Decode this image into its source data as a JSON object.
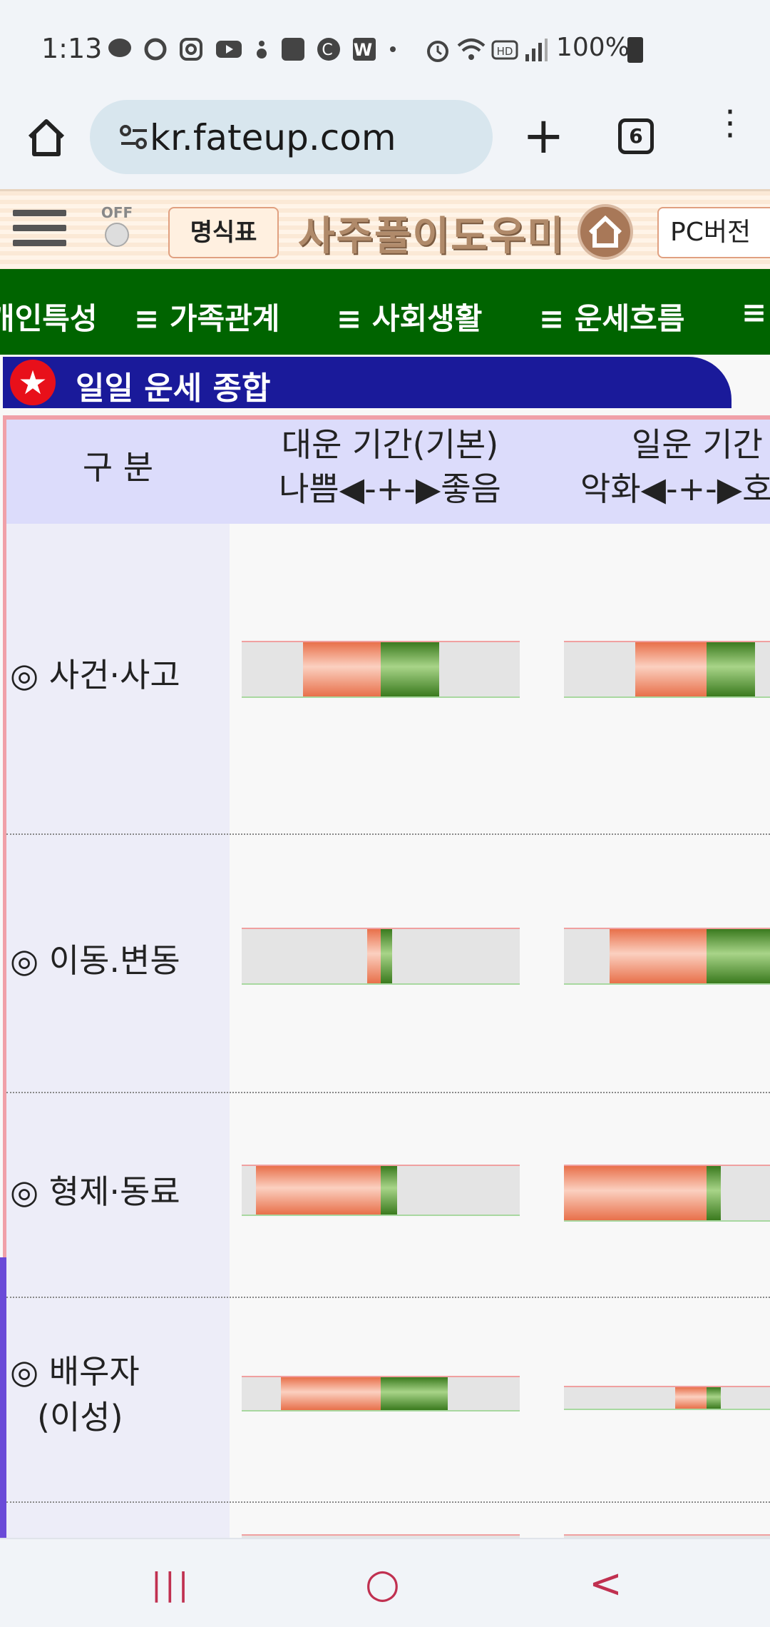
{
  "status_bar": {
    "time": "1:13",
    "battery": "100%",
    "icons": [
      "talk-icon",
      "chat-icon",
      "instagram-icon",
      "youtube-icon",
      "app-icon",
      "ably-icon",
      "c-icon",
      "w-icon",
      "dot-icon",
      "alarm-icon",
      "wifi-icon",
      "hd-icon",
      "signal-icon",
      "battery-icon"
    ]
  },
  "browser": {
    "url": "kr.fateup.com",
    "tab_count": "6"
  },
  "site_header": {
    "menu_label": "명식표",
    "bulb_label": "OFF",
    "logo_text": "사주풀이도우미",
    "pc_label": "PC버전"
  },
  "nav": {
    "items": [
      "개인특성",
      "≡ 가족관계",
      "≡ 사회생활",
      "≡ 운세흐름",
      "≡"
    ]
  },
  "section": {
    "title": "일일 운세 종합"
  },
  "table": {
    "header": {
      "col0": "구 분",
      "col1_line1": "대운 기간(기본)",
      "col1_line2": "나쁨◀-+-▶좋음",
      "col2_line1": "일운 기간",
      "col2_line2": "악화◀-+-▶호"
    },
    "rows": [
      {
        "label": "◎ 사건·사고",
        "label2": "",
        "col1": {
          "neg": 0.28,
          "pos": 0.21
        },
        "col2": {
          "neg": 0.25,
          "pos": 0.17
        }
      },
      {
        "label": "◎ 이동.변동",
        "label2": "",
        "col1": {
          "neg": 0.05,
          "pos": 0.04
        },
        "col2": {
          "neg": 0.34,
          "pos": 0.26
        }
      },
      {
        "label": "◎ 형제·동료",
        "label2": "",
        "col1": {
          "neg": 0.45,
          "pos": 0.06
        },
        "col2": {
          "neg": 0.6,
          "pos": 0.05
        }
      },
      {
        "label": "◎ 배우자",
        "label2": "(이성)",
        "col1": {
          "neg": 0.36,
          "pos": 0.24
        },
        "col2": {
          "neg": 0.11,
          "pos": 0.05
        }
      }
    ]
  },
  "android_nav": {
    "recents": "|||",
    "home": "○",
    "back": "<"
  }
}
